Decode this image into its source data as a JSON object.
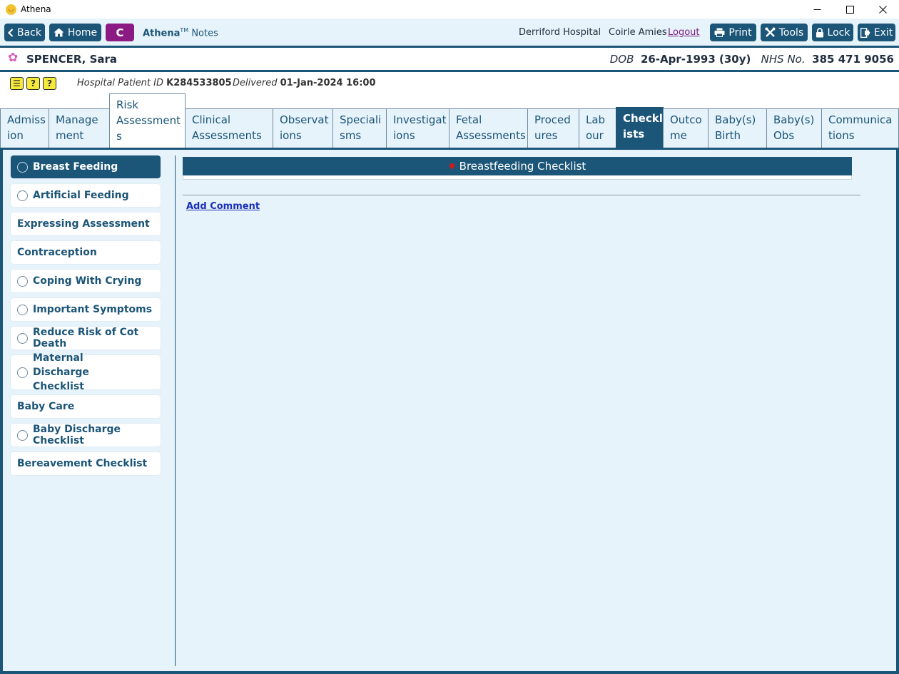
{
  "window": {
    "title": "Athena",
    "controls": {
      "minimize": "—",
      "maximize": "☐",
      "close": "✕"
    }
  },
  "toolbar": {
    "back_label": "Back",
    "home_label": "Home",
    "badge_letter": "C",
    "brand_name": "Athena",
    "brand_tm": "TM",
    "brand_suffix": "Notes",
    "hospital": "Derriford Hospital",
    "user": "Coirle Amies",
    "logout_label": "Logout",
    "print_label": "Print",
    "tools_label": "Tools",
    "lock_label": "Lock",
    "exit_label": "Exit"
  },
  "patient": {
    "name": "SPENCER, Sara",
    "dob_label": "DOB",
    "dob": "26-Apr-1993 (30y)",
    "nhs_label": "NHS No.",
    "nhs_number": "385 471 9056"
  },
  "info": {
    "hospital_id_label": "Hospital Patient ID",
    "hospital_id": "K284533805",
    "delivered_label": "Delivered",
    "delivered": "01-Jan-2024 16:00",
    "alert_icons": [
      "list-alert",
      "question-alert",
      "question-alert"
    ]
  },
  "tabs": [
    {
      "label": "Admiss\nion"
    },
    {
      "label": "Manage\nment"
    },
    {
      "label": "Risk\nAssessment\ns"
    },
    {
      "label": "Clinical\nAssessments"
    },
    {
      "label": "Observat\nions"
    },
    {
      "label": "Speciali\nsms"
    },
    {
      "label": "Investigat\nions"
    },
    {
      "label": "Fetal\nAssessments"
    },
    {
      "label": "Proced\nures"
    },
    {
      "label": "Lab\nour"
    },
    {
      "label": "Checkl\nists"
    },
    {
      "label": "Outco\nme"
    },
    {
      "label": "Baby(s)\nBirth"
    },
    {
      "label": "Baby(s)\nObs"
    },
    {
      "label": "Communica\ntions"
    }
  ],
  "active_tab": "Checklists",
  "sidebar": {
    "items": [
      {
        "label": "Breast Feeding",
        "radio": true,
        "active": true
      },
      {
        "label": "Artificial Feeding",
        "radio": true
      },
      {
        "label": "Expressing Assessment",
        "radio": false
      },
      {
        "label": "Contraception",
        "radio": false
      },
      {
        "label": "Coping With Crying",
        "radio": true
      },
      {
        "label": "Important Symptoms",
        "radio": true
      },
      {
        "label": "Reduce Risk of Cot Death",
        "radio": true
      },
      {
        "label": "Maternal Discharge Checklist",
        "radio": true
      },
      {
        "label": "Baby Care",
        "radio": false
      },
      {
        "label": "Baby Discharge Checklist",
        "radio": true
      },
      {
        "label": "Bereavement Checklist",
        "radio": false
      }
    ]
  },
  "main": {
    "section_title": "Breastfeeding Checklist",
    "add_comment_label": "Add Comment"
  },
  "colors": {
    "primary": "#1b5577",
    "background": "#e6f3fb",
    "badge": "#8b1a82",
    "alert_yellow": "#f5e93a",
    "link": "#1a2fb8"
  }
}
